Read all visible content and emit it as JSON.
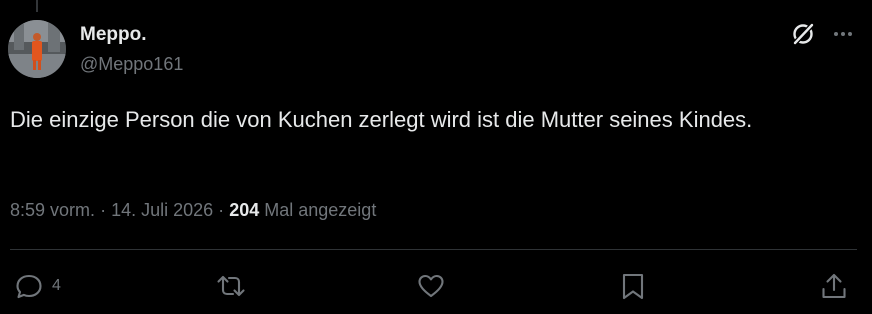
{
  "tweet": {
    "display_name": "Meppo.",
    "handle": "@Meppo161",
    "text": "Die einzige Person die von Kuchen zerlegt wird ist die Mutter seines Kindes.",
    "time": "8:59 vorm.",
    "date": "14. Juli 2026",
    "views_count": "204",
    "views_label": "Mal angezeigt",
    "separator": "·"
  },
  "actions": {
    "reply_count": "4"
  },
  "icons": {
    "grok": "grok-icon",
    "more": "more-icon",
    "reply": "reply-icon",
    "retweet": "retweet-icon",
    "like": "like-icon",
    "bookmark": "bookmark-icon",
    "share": "share-icon"
  },
  "colors": {
    "background": "#000000",
    "text": "#e7e9ea",
    "secondary": "#71767b",
    "divider": "#2f3336"
  }
}
